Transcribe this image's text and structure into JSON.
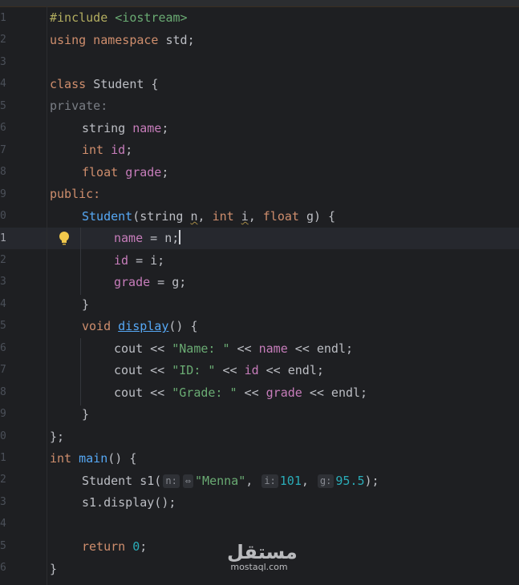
{
  "editor": {
    "line_numbers": [
      "1",
      "2",
      "3",
      "4",
      "5",
      "6",
      "7",
      "8",
      "9",
      "0",
      "1",
      "2",
      "3",
      "4",
      "5",
      "6",
      "7",
      "8",
      "9",
      "0",
      "1",
      "2",
      "3",
      "4",
      "5",
      "6"
    ],
    "current_line_index": 10,
    "code": {
      "l1_a": "#include ",
      "l1_b": "<iostream>",
      "l2_a": "using namespace ",
      "l2_b": "std;",
      "l4_a": "class ",
      "l4_b": "Student {",
      "l5": "private:",
      "l6_a": "string ",
      "l6_b": "name",
      "l6_c": ";",
      "l7_a": "int ",
      "l7_b": "id",
      "l7_c": ";",
      "l8_a": "float ",
      "l8_b": "grade",
      "l8_c": ";",
      "l9": "public:",
      "l10_a": "Student",
      "l10_b": "(string ",
      "l10_c": "n",
      "l10_d": ", ",
      "l10_e": "int ",
      "l10_f": "i",
      "l10_g": ", ",
      "l10_h": "float ",
      "l10_i": "g",
      "l10_j": ") {",
      "l11_a": "name",
      "l11_b": " = n;",
      "l12_a": "id",
      "l12_b": " = i;",
      "l13_a": "grade",
      "l13_b": " = g;",
      "l14": "}",
      "l15_a": "void ",
      "l15_b": "display",
      "l15_c": "() {",
      "l16_a": "cout << ",
      "l16_b": "\"Name: \"",
      "l16_c": " << ",
      "l16_d": "name",
      "l16_e": " << endl;",
      "l17_a": "cout << ",
      "l17_b": "\"ID: \"",
      "l17_c": " << ",
      "l17_d": "id",
      "l17_e": " << endl;",
      "l18_a": "cout << ",
      "l18_b": "\"Grade: \"",
      "l18_c": " << ",
      "l18_d": "grade",
      "l18_e": " << endl;",
      "l19": "}",
      "l20": "};",
      "l21_a": "int ",
      "l21_b": "main",
      "l21_c": "() {",
      "l22_a": "Student s1(",
      "l22_hint_n": "n:",
      "l22_hint_icon": "⇔",
      "l22_s": "\"Menna\"",
      "l22_c1": ", ",
      "l22_hint_i": "i:",
      "l22_n1": "101",
      "l22_c2": ", ",
      "l22_hint_g": "g:",
      "l22_n2": "95.5",
      "l22_end": ");",
      "l23": "s1.display();",
      "l25_a": "return ",
      "l25_b": "0",
      "l25_c": ";",
      "l26": "}"
    }
  },
  "watermark": {
    "arabic": "مستقل",
    "latin": "mostaql.com"
  },
  "icons": {
    "bulb": "lightbulb-icon"
  },
  "colors": {
    "background": "#1e1f22",
    "keyword": "#cf8e6d",
    "string": "#6aab73",
    "number": "#2aacb8",
    "field": "#c77dbb",
    "function": "#56a8f5"
  }
}
